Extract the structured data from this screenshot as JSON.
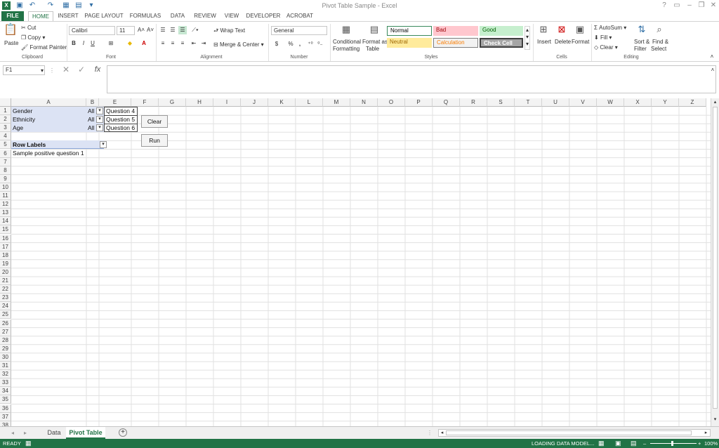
{
  "window": {
    "title": "Pivot Table Sample - Excel"
  },
  "ribbon_tabs": [
    "FILE",
    "HOME",
    "INSERT",
    "PAGE LAYOUT",
    "FORMULAS",
    "DATA",
    "REVIEW",
    "VIEW",
    "DEVELOPER",
    "ACROBAT"
  ],
  "clipboard": {
    "paste": "Paste",
    "cut": "Cut",
    "copy": "Copy",
    "format_painter": "Format Painter",
    "label": "Clipboard"
  },
  "font": {
    "name": "Calibri",
    "size": "11",
    "bold": "B",
    "italic": "I",
    "underline": "U",
    "label": "Font"
  },
  "alignment": {
    "wrap": "Wrap Text",
    "merge": "Merge & Center",
    "label": "Alignment"
  },
  "number": {
    "format": "General",
    "currency": "$",
    "percent": "%",
    "comma": ",",
    "label": "Number"
  },
  "styles": {
    "conditional_1": "Conditional",
    "conditional_2": "Formatting",
    "format_as_1": "Format as",
    "format_as_2": "Table",
    "normal": "Normal",
    "bad": "Bad",
    "good": "Good",
    "neutral": "Neutral",
    "calculation": "Calculation",
    "check_cell": "Check Cell",
    "label": "Styles"
  },
  "cells": {
    "insert": "Insert",
    "delete": "Delete",
    "format": "Format",
    "label": "Cells"
  },
  "editing": {
    "autosum": "AutoSum",
    "fill": "Fill",
    "clear": "Clear",
    "sort_1": "Sort &",
    "sort_2": "Filter",
    "find_1": "Find &",
    "find_2": "Select",
    "label": "Editing"
  },
  "formula_bar": {
    "name_box": "F1",
    "value": ""
  },
  "columns": [
    "A",
    "B",
    "E",
    "F",
    "G",
    "H",
    "I",
    "J",
    "K",
    "L",
    "M",
    "N",
    "O",
    "P",
    "Q",
    "R",
    "S",
    "T",
    "U",
    "V",
    "W",
    "X",
    "Y",
    "Z"
  ],
  "rows": [
    "1",
    "2",
    "3",
    "4",
    "5",
    "6",
    "7",
    "8",
    "9",
    "10",
    "11",
    "12",
    "13",
    "14",
    "15",
    "16",
    "17",
    "18",
    "19",
    "20",
    "21",
    "22",
    "23",
    "24",
    "25",
    "26",
    "27",
    "28",
    "29",
    "30",
    "31",
    "32",
    "33",
    "34",
    "35",
    "36",
    "37",
    "38"
  ],
  "sheet": {
    "slicers": [
      {
        "label": "Gender",
        "value": "All"
      },
      {
        "label": "Ethnicity",
        "value": "All"
      },
      {
        "label": "Age",
        "value": "All"
      }
    ],
    "questions": [
      "Question 4",
      "Question 5",
      "Question 6"
    ],
    "clear_button": "Clear",
    "run_button": "Run",
    "row_labels": "Row Labels",
    "row6": "Sample positive question 1"
  },
  "sheet_tabs": [
    "Data",
    "Pivot Table"
  ],
  "status": {
    "left": "READY",
    "loading": "LOADING DATA MODEL...",
    "zoom": "100%"
  }
}
